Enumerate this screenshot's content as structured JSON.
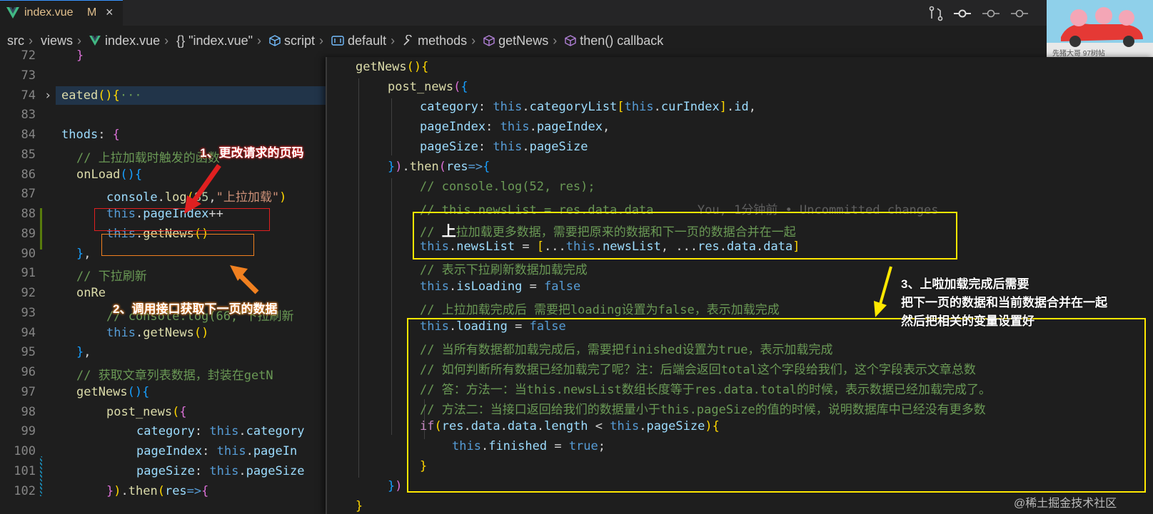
{
  "tab": {
    "filename": "index.vue",
    "modified": "M",
    "close": "×"
  },
  "breadcrumbs": [
    "src",
    "views",
    "index.vue",
    "{} \"index.vue\"",
    "script",
    "default",
    "methods",
    "getNews",
    "then() callback"
  ],
  "left_lines": [
    {
      "num": "72",
      "indent": 1,
      "tokens": [
        [
          "}",
          "br2"
        ]
      ]
    },
    {
      "num": "73",
      "indent": 0,
      "tokens": []
    },
    {
      "num": "74",
      "indent": 0,
      "fold": true,
      "tokens": [
        [
          "eated",
          "fn"
        ],
        [
          "()",
          "br1"
        ],
        [
          "{",
          "br1"
        ],
        [
          "···",
          "cm"
        ]
      ]
    },
    {
      "num": "83",
      "indent": 0,
      "tokens": []
    },
    {
      "num": "84",
      "indent": 0,
      "tokens": [
        [
          "thods",
          "pr"
        ],
        [
          ": ",
          "op"
        ],
        [
          "{",
          "br2"
        ]
      ]
    },
    {
      "num": "85",
      "indent": 1,
      "tokens": [
        [
          "// 上拉加载时触发的函数",
          "cm"
        ]
      ]
    },
    {
      "num": "86",
      "indent": 1,
      "tokens": [
        [
          "onLoad",
          "fn"
        ],
        [
          "()",
          "br3"
        ],
        [
          "{",
          "br3"
        ]
      ]
    },
    {
      "num": "87",
      "indent": 3,
      "tokens": [
        [
          "console",
          "pr"
        ],
        [
          ".",
          "op"
        ],
        [
          "log",
          "fn"
        ],
        [
          "(",
          "br1"
        ],
        [
          "85",
          "nm"
        ],
        [
          ",",
          "op"
        ],
        [
          "\"上拉加载\"",
          "st"
        ],
        [
          ")",
          "br1"
        ]
      ]
    },
    {
      "num": "88",
      "indent": 3,
      "tokens": [
        [
          "this",
          "kw"
        ],
        [
          ".",
          "op"
        ],
        [
          "pageIndex",
          "pr"
        ],
        [
          "++",
          "op"
        ]
      ]
    },
    {
      "num": "89",
      "indent": 3,
      "tokens": [
        [
          "this",
          "kw"
        ],
        [
          ".",
          "op"
        ],
        [
          "getNews",
          "fn"
        ],
        [
          "()",
          "br1"
        ]
      ]
    },
    {
      "num": "90",
      "indent": 1,
      "tokens": [
        [
          "}",
          "br3"
        ],
        [
          ",",
          "op"
        ]
      ]
    },
    {
      "num": "91",
      "indent": 1,
      "tokens": [
        [
          "// 下拉刷新",
          "cm"
        ]
      ]
    },
    {
      "num": "92",
      "indent": 1,
      "tokens": [
        [
          "onRe",
          "fn"
        ]
      ]
    },
    {
      "num": "93",
      "indent": 3,
      "tokens": [
        [
          "// console.log(66,\"下拉刷新",
          "cm"
        ]
      ]
    },
    {
      "num": "94",
      "indent": 3,
      "tokens": [
        [
          "this",
          "kw"
        ],
        [
          ".",
          "op"
        ],
        [
          "getNews",
          "fn"
        ],
        [
          "()",
          "br1"
        ]
      ]
    },
    {
      "num": "95",
      "indent": 1,
      "tokens": [
        [
          "}",
          "br3"
        ],
        [
          ",",
          "op"
        ]
      ]
    },
    {
      "num": "96",
      "indent": 1,
      "tokens": [
        [
          "// 获取文章列表数据，封装在getN",
          "cm"
        ]
      ]
    },
    {
      "num": "97",
      "indent": 1,
      "tokens": [
        [
          "getNews",
          "fn"
        ],
        [
          "()",
          "br3"
        ],
        [
          "{",
          "br3"
        ]
      ]
    },
    {
      "num": "98",
      "indent": 3,
      "tokens": [
        [
          "post_news",
          "fn"
        ],
        [
          "(",
          "br1"
        ],
        [
          "{",
          "br2"
        ]
      ]
    },
    {
      "num": "99",
      "indent": 5,
      "tokens": [
        [
          "category",
          "pr"
        ],
        [
          ": ",
          "op"
        ],
        [
          "this",
          "kw"
        ],
        [
          ".",
          "op"
        ],
        [
          "category",
          "pr"
        ]
      ]
    },
    {
      "num": "100",
      "indent": 5,
      "tokens": [
        [
          "pageIndex",
          "pr"
        ],
        [
          ": ",
          "op"
        ],
        [
          "this",
          "kw"
        ],
        [
          ".",
          "op"
        ],
        [
          "pageIn",
          "pr"
        ]
      ]
    },
    {
      "num": "101",
      "indent": 5,
      "tokens": [
        [
          "pageSize",
          "pr"
        ],
        [
          ": ",
          "op"
        ],
        [
          "this",
          "kw"
        ],
        [
          ".",
          "op"
        ],
        [
          "pageSize",
          "pr"
        ]
      ]
    },
    {
      "num": "102",
      "indent": 3,
      "tokens": [
        [
          "}",
          "br2"
        ],
        [
          ")",
          "br1"
        ],
        [
          ".",
          "op"
        ],
        [
          "then",
          "fn"
        ],
        [
          "(",
          "br1"
        ],
        [
          "res",
          "pr"
        ],
        [
          "=>",
          "kw"
        ],
        [
          "{",
          "br2"
        ]
      ]
    }
  ],
  "overlay_lines": [
    {
      "indent": 0,
      "tokens": [
        [
          "getNews",
          "fn"
        ],
        [
          "()",
          "br1"
        ],
        [
          "{",
          "br1"
        ]
      ]
    },
    {
      "indent": 1,
      "tokens": [
        [
          "post_news",
          "fn"
        ],
        [
          "(",
          "br2"
        ],
        [
          "{",
          "br3"
        ]
      ]
    },
    {
      "indent": 2,
      "tokens": [
        [
          "category",
          "pr"
        ],
        [
          ": ",
          "op"
        ],
        [
          "this",
          "kw"
        ],
        [
          ".",
          "op"
        ],
        [
          "categoryList",
          "pr"
        ],
        [
          "[",
          "br1"
        ],
        [
          "this",
          "kw"
        ],
        [
          ".",
          "op"
        ],
        [
          "curIndex",
          "pr"
        ],
        [
          "]",
          "br1"
        ],
        [
          ".",
          "op"
        ],
        [
          "id",
          "pr"
        ],
        [
          ",",
          "op"
        ]
      ]
    },
    {
      "indent": 2,
      "tokens": [
        [
          "pageIndex",
          "pr"
        ],
        [
          ": ",
          "op"
        ],
        [
          "this",
          "kw"
        ],
        [
          ".",
          "op"
        ],
        [
          "pageIndex",
          "pr"
        ],
        [
          ",",
          "op"
        ]
      ]
    },
    {
      "indent": 2,
      "tokens": [
        [
          "pageSize",
          "pr"
        ],
        [
          ": ",
          "op"
        ],
        [
          "this",
          "kw"
        ],
        [
          ".",
          "op"
        ],
        [
          "pageSize",
          "pr"
        ]
      ]
    },
    {
      "indent": 1,
      "tokens": [
        [
          "}",
          "br3"
        ],
        [
          ")",
          "br2"
        ],
        [
          ".",
          "op"
        ],
        [
          "then",
          "fn"
        ],
        [
          "(",
          "br2"
        ],
        [
          "res",
          "pr"
        ],
        [
          "=>",
          "kw"
        ],
        [
          "{",
          "br3"
        ]
      ]
    },
    {
      "indent": 2,
      "tokens": [
        [
          "// console.log(52, res);",
          "cm"
        ]
      ]
    },
    {
      "indent": 2,
      "tokens": [
        [
          "// this.newsList = res.data.data",
          "cm"
        ],
        [
          "      You, 1分钟前 • Uncommitted changes",
          "blame"
        ]
      ]
    },
    {
      "indent": 2,
      "tokens": [
        [
          "// ",
          "cm"
        ],
        [
          "上",
          "bigwhite"
        ],
        [
          "拉加载更多数据，需要把原来的数据和下一页的数据合并在一起",
          "cm"
        ]
      ]
    },
    {
      "indent": 2,
      "tokens": [
        [
          "this",
          "kw"
        ],
        [
          ".",
          "op"
        ],
        [
          "newsList",
          "pr"
        ],
        [
          " = ",
          "op"
        ],
        [
          "[",
          "br1"
        ],
        [
          "...",
          "op"
        ],
        [
          "this",
          "kw"
        ],
        [
          ".",
          "op"
        ],
        [
          "newsList",
          "pr"
        ],
        [
          ", ",
          "op"
        ],
        [
          "...",
          "op"
        ],
        [
          "res",
          "pr"
        ],
        [
          ".",
          "op"
        ],
        [
          "data",
          "pr"
        ],
        [
          ".",
          "op"
        ],
        [
          "data",
          "pr"
        ],
        [
          "]",
          "br1"
        ]
      ]
    },
    {
      "indent": 2,
      "tokens": [
        [
          "// 表示下拉刷新数据加载完成",
          "cm"
        ]
      ]
    },
    {
      "indent": 2,
      "tokens": [
        [
          "this",
          "kw"
        ],
        [
          ".",
          "op"
        ],
        [
          "isLoading",
          "pr"
        ],
        [
          " = ",
          "op"
        ],
        [
          "false",
          "kw"
        ]
      ]
    },
    {
      "indent": 2,
      "tokens": [
        [
          "// 上拉加载完成后 需要把loading设置为false，表示加载完成",
          "cm"
        ]
      ]
    },
    {
      "indent": 2,
      "tokens": [
        [
          "this",
          "kw"
        ],
        [
          ".",
          "op"
        ],
        [
          "loading",
          "pr"
        ],
        [
          " = ",
          "op"
        ],
        [
          "false",
          "kw"
        ]
      ]
    },
    {
      "indent": 2,
      "tokens": [
        [
          "// 当所有数据都加载完成后，需要把finished设置为true，表示加载完成",
          "cm"
        ]
      ]
    },
    {
      "indent": 2,
      "tokens": [
        [
          "// 如何判断所有数据已经加载完了呢？注：后端会返回total这个字段给我们，这个字段表示文章总数",
          "cm"
        ]
      ]
    },
    {
      "indent": 2,
      "tokens": [
        [
          "// 答：方法一：当this.newsList数组长度等于res.data.total的时候，表示数据已经加载完成了。",
          "cm"
        ]
      ]
    },
    {
      "indent": 2,
      "tokens": [
        [
          "// 方法二：当接口返回给我们的数据量小于this.pageSize的值的时候，说明数据库中已经没有更多数",
          "cm"
        ]
      ]
    },
    {
      "indent": 2,
      "tokens": [
        [
          "if",
          "pu"
        ],
        [
          "(",
          "br1"
        ],
        [
          "res",
          "pr"
        ],
        [
          ".",
          "op"
        ],
        [
          "data",
          "pr"
        ],
        [
          ".",
          "op"
        ],
        [
          "data",
          "pr"
        ],
        [
          ".",
          "op"
        ],
        [
          "length",
          "pr"
        ],
        [
          " < ",
          "op"
        ],
        [
          "this",
          "kw"
        ],
        [
          ".",
          "op"
        ],
        [
          "pageSize",
          "pr"
        ],
        [
          ")",
          "br1"
        ],
        [
          "{",
          "br1"
        ]
      ]
    },
    {
      "indent": 3,
      "tokens": [
        [
          "this",
          "kw"
        ],
        [
          ".",
          "op"
        ],
        [
          "finished",
          "pr"
        ],
        [
          " = ",
          "op"
        ],
        [
          "true",
          "kw"
        ],
        [
          ";",
          "op"
        ]
      ]
    },
    {
      "indent": 2,
      "tokens": [
        [
          "}",
          "br1"
        ]
      ]
    },
    {
      "indent": 1,
      "tokens": [
        [
          "}",
          "br3"
        ],
        [
          ")",
          "br2"
        ]
      ]
    },
    {
      "indent": 0,
      "tokens": [
        [
          "}",
          "br1"
        ]
      ]
    }
  ],
  "annotations": {
    "a1": "1、更改请求的页码",
    "a2": "2、调用接口获取下一页的数据",
    "a3_line1": "3、上啦加载完成后需要",
    "a3_line2": "把下一页的数据和当前数据合并在一起",
    "a3_line3": "然后把相关的变量设置好"
  },
  "avatar_text": "先猪大哥  97树帖",
  "watermark": "@稀土掘金技术社区",
  "colors": {
    "accent": "#3794ff",
    "red": "#e02020",
    "orange": "#f08020",
    "yellow": "#ffe800"
  }
}
